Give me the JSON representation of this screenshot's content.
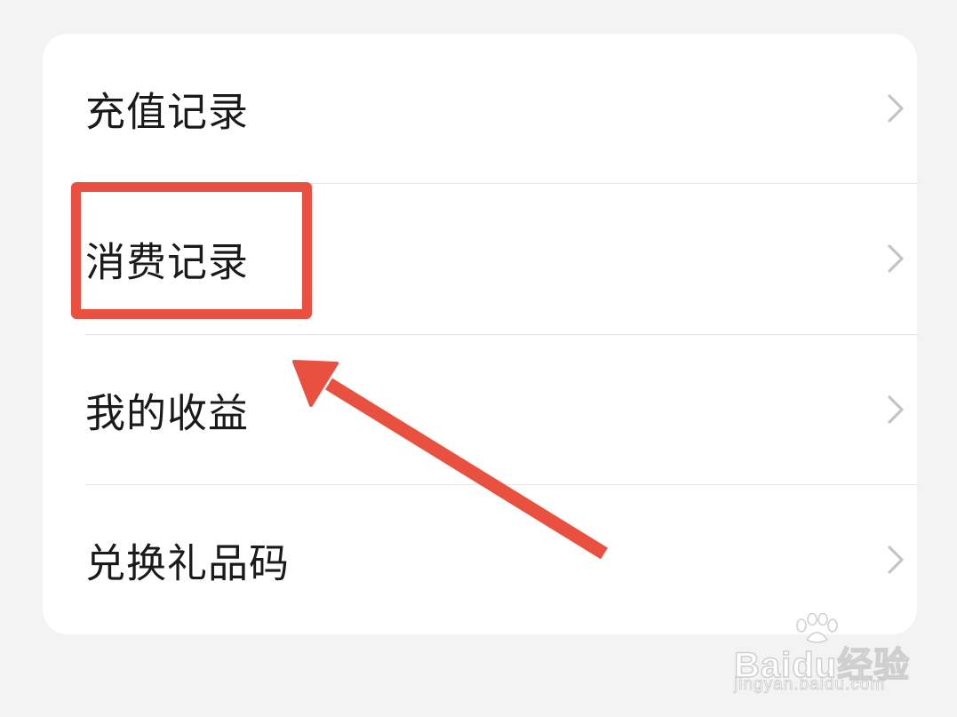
{
  "menu": {
    "items": [
      {
        "label": "充值记录",
        "icon": "chevron-right-icon"
      },
      {
        "label": "消费记录",
        "icon": "chevron-right-icon"
      },
      {
        "label": "我的收益",
        "icon": "chevron-right-icon"
      },
      {
        "label": "兑换礼品码",
        "icon": "chevron-right-icon"
      }
    ]
  },
  "annotation": {
    "highlighted_item": "消费记录",
    "color": "#e9503f"
  },
  "watermark": {
    "brand": "Baidu经验",
    "url": "jingyan.baidu.com"
  },
  "colors": {
    "background": "#f3f3f3",
    "card": "#ffffff",
    "text": "#1a1a1a",
    "chevron": "#c4c4c4",
    "divider": "#e4e4e4"
  }
}
